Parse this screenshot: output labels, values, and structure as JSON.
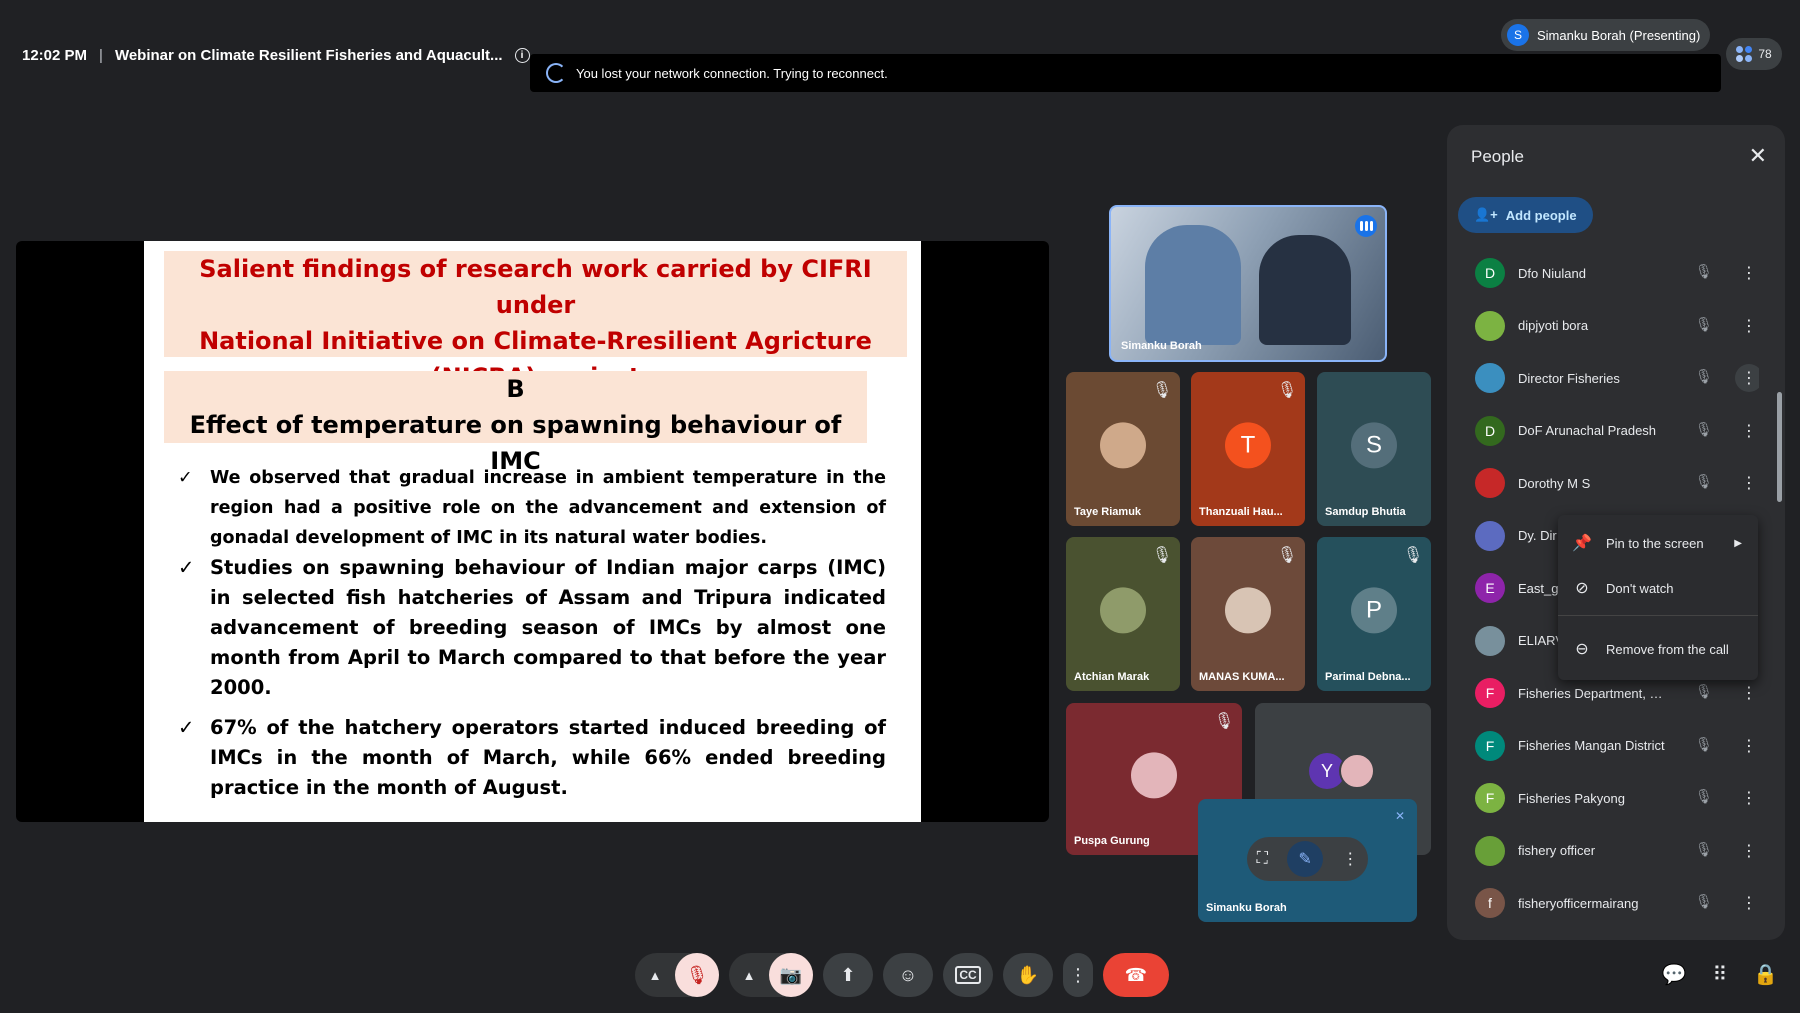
{
  "topbar": {
    "time": "12:02 PM",
    "separator": "|",
    "meeting_title": "Webinar on Climate Resilient Fisheries and Aquacult...",
    "info_glyph": "i"
  },
  "network_banner": {
    "text": "You lost your network connection. Trying to reconnect."
  },
  "presenter": {
    "avatar_letter": "S",
    "label": "Simanku Borah (Presenting)"
  },
  "participants": {
    "count": "78"
  },
  "slide": {
    "title_lines": [
      "Salient findings of research work carried by CIFRI  under",
      "National Initiative on Climate-Rresilient Agricture",
      "(NICRA) project"
    ],
    "section_letter": "B",
    "section_title": "Effect of temperature on spawning behaviour of IMC",
    "check_glyph": "✓",
    "points": [
      "We observed that gradual increase in ambient temperature in the region had a positive role on the advancement and extension of gonadal development of IMC in its natural water bodies.",
      "Studies on spawning behaviour of Indian major carps (IMC) in selected fish hatcheries of Assam and Tripura indicated advancement of breeding season of IMCs by almost one month from April to March compared to that before the year 2000.",
      "67% of the hatchery operators started induced breeding of IMCs in the month of March, while 66% ended breeding practice in the month of August."
    ]
  },
  "main_video": {
    "name": "Simanku Borah"
  },
  "tiles": [
    {
      "name": "Taye Riamuk",
      "letter": "",
      "bg": "#6b4a33",
      "av": "#cfa98a"
    },
    {
      "name": "Thanzuali Hau...",
      "letter": "T",
      "bg": "#a3391a",
      "av": "#f4511e"
    },
    {
      "name": "Samdup Bhutia",
      "letter": "S",
      "bg": "#2e4c54",
      "av": "#546e7a"
    },
    {
      "name": "Atchian Marak",
      "letter": "",
      "bg": "#4a5230",
      "av": "#8f9b6a"
    },
    {
      "name": "MANAS KUMA...",
      "letter": "",
      "bg": "#6d4a3a",
      "av": "#d8c4b4"
    },
    {
      "name": "Parimal Debna...",
      "letter": "P",
      "bg": "#25505c",
      "av": "#5f7f89"
    },
    {
      "name": "Puspa Gurung",
      "letter": "",
      "bg": "#7b2a30",
      "av": "#e3b5ba"
    }
  ],
  "tile_extra": {
    "letter": "Y"
  },
  "self_view": {
    "name": "Simanku Borah"
  },
  "people_panel": {
    "title": "People",
    "close_glyph": "✕",
    "add_label": "Add people",
    "rows": [
      {
        "name": "Dfo Niuland",
        "letter": "D",
        "color": "#0b8043"
      },
      {
        "name": "dipjyoti bora",
        "letter": "",
        "color": "#7cb342"
      },
      {
        "name": "Director Fisheries",
        "letter": "",
        "color": "#3b8fbf"
      },
      {
        "name": "DoF Arunachal Pradesh",
        "letter": "D",
        "color": "#33691e"
      },
      {
        "name": "Dorothy M S",
        "letter": "",
        "color": "#c62828"
      },
      {
        "name": "Dy. Dir",
        "letter": "",
        "color": "#5c6bc0"
      },
      {
        "name": "East_g",
        "letter": "E",
        "color": "#8e24aa"
      },
      {
        "name": "ELIARV",
        "letter": "",
        "color": "#78909c"
      },
      {
        "name": "Fisheries Department, S...",
        "letter": "F",
        "color": "#e91e63"
      },
      {
        "name": "Fisheries Mangan District",
        "letter": "F",
        "color": "#00897b"
      },
      {
        "name": "Fisheries Pakyong",
        "letter": "F",
        "color": "#7cb342"
      },
      {
        "name": "fishery officer",
        "letter": "",
        "color": "#689f38"
      },
      {
        "name": "fisheryofficermairang",
        "letter": "f",
        "color": "#795548"
      }
    ]
  },
  "context_menu": {
    "items": [
      "Pin to the screen",
      "Don't watch",
      "Remove from the call"
    ]
  },
  "icons": {
    "mic_off": "mic-off-icon",
    "cam_off": "camera-off-icon",
    "present": "present-icon",
    "emoji": "emoji-icon",
    "captions": "captions-icon",
    "hand": "raise-hand-icon",
    "more": "more-vert-icon",
    "end": "end-call-icon",
    "chat": "chat-icon",
    "apps": "apps-icon",
    "host": "host-controls-icon"
  }
}
